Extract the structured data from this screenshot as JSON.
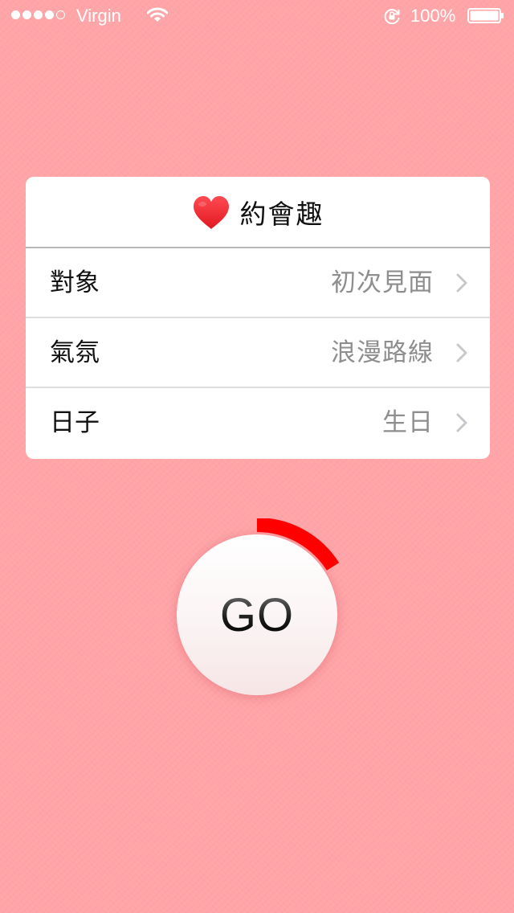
{
  "status_bar": {
    "carrier": "Virgin",
    "signal_bars_filled": 4,
    "signal_bars_total": 5,
    "battery_percent_label": "100%",
    "battery_level": 1.0,
    "icons": [
      "signal-dots-icon",
      "wifi-icon",
      "rotation-lock-icon",
      "battery-icon"
    ]
  },
  "card": {
    "title": "約會趣",
    "title_icon": "heart-icon",
    "rows": [
      {
        "label": "對象",
        "value": "初次見面",
        "icon": "chevron-right-icon"
      },
      {
        "label": "氣氛",
        "value": "浪漫路線",
        "icon": "chevron-right-icon"
      },
      {
        "label": "日子",
        "value": "生日",
        "icon": "chevron-right-icon"
      }
    ]
  },
  "go_button": {
    "label": "GO",
    "progress": 0.16
  },
  "colors": {
    "background": "#ffa5a8",
    "heart": "#f2242c",
    "progress_arc": "#ff0000",
    "card": "#ffffff",
    "value_text": "#8e8e8e"
  }
}
